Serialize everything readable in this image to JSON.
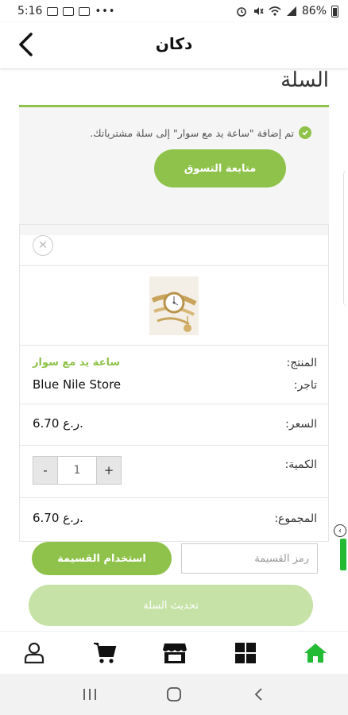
{
  "status_bar": {
    "time": "5:16",
    "battery": "86%"
  },
  "header": {
    "title": "دكان"
  },
  "page": {
    "title": "السلة"
  },
  "notice": {
    "message": "تم إضافة \"ساعة يد مع سوار\" إلى سلة مشترياتك.",
    "continue_label": "متابعة التسوق"
  },
  "cart": {
    "product_label": "المنتج:",
    "product_name": "ساعة يد مع سوار",
    "vendor_label": "تاجر:",
    "vendor_name": "Blue Nile Store",
    "price_label": "السعر:",
    "price_value": "6.70 ر.ع.",
    "quantity_label": "الكمية:",
    "quantity_value": "1",
    "minus": "-",
    "plus": "+",
    "total_label": "المجموع:",
    "total_value": "6.70 ر.ع."
  },
  "coupon": {
    "placeholder": "رمز القسيمة",
    "apply_label": "استخدام القسيمة"
  },
  "update_cart_label": "تحديث السلة",
  "colors": {
    "accent": "#8fc24b",
    "home_active": "#22bb33"
  },
  "bottom_nav": {
    "items": [
      {
        "icon": "user-icon"
      },
      {
        "icon": "cart-icon"
      },
      {
        "icon": "store-icon"
      },
      {
        "icon": "grid-icon"
      },
      {
        "icon": "home-icon"
      }
    ]
  }
}
